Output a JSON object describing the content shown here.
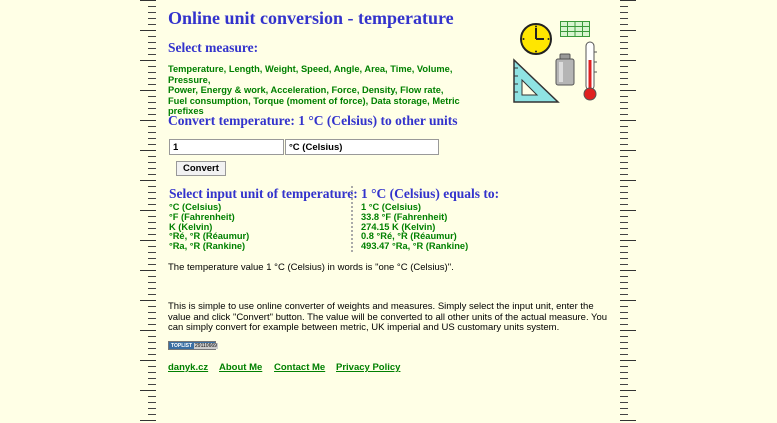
{
  "title": "Online unit conversion - temperature",
  "select_measure": {
    "heading": "Select measure:",
    "lines": [
      [
        "Temperature",
        "Length",
        "Weight",
        "Speed",
        "Angle",
        "Area",
        "Time",
        "Volume",
        "Pressure"
      ],
      [
        "Power",
        "Energy & work",
        "Acceleration",
        "Force",
        "Density",
        "Flow rate"
      ],
      [
        "Fuel consumption",
        "Torque (moment of force)",
        "Data storage",
        "Metric prefixes"
      ]
    ]
  },
  "convert_heading": "Convert temperature: 1 °C (Celsius) to other units",
  "form": {
    "value": "1",
    "unit": "°C (Celsius)",
    "convert_label": "Convert"
  },
  "input_units": {
    "heading": "Select input unit of temperature:",
    "items": [
      "°C (Celsius)",
      "°F (Fahrenheit)",
      "K (Kelvin)",
      "°Ré, °R (Réaumur)",
      "°Ra, °R (Rankine)"
    ]
  },
  "results": {
    "heading": "1 °C (Celsius) equals to:",
    "items": [
      "1 °C (Celsius)",
      "33.8 °F (Fahrenheit)",
      "274.15 K (Kelvin)",
      "0.8 °Ré, °R (Réaumur)",
      "493.47 °Ra, °R (Rankine)"
    ]
  },
  "words_text": "The temperature value 1 °C (Celsius) in words is \"one °C (Celsius)\".",
  "description": "This is simple to use online converter of weights and measures. Simply select the input unit, enter the value and click \"Convert\" button. The value will be converted to all other units of the actual measure. You can simply convert for example between metric, UK imperial and US customary units system.",
  "badge": {
    "label": "TOPLIST",
    "count": "29110669"
  },
  "footer": [
    "danyk.cz",
    "About Me",
    "Contact Me",
    "Privacy Policy"
  ],
  "colors": {
    "background": "#ffffe6",
    "heading": "#3333cc",
    "link": "#008000"
  },
  "icons": [
    "clock-icon",
    "grid-icon",
    "set-square-icon",
    "weight-icon",
    "thermometer-icon"
  ]
}
